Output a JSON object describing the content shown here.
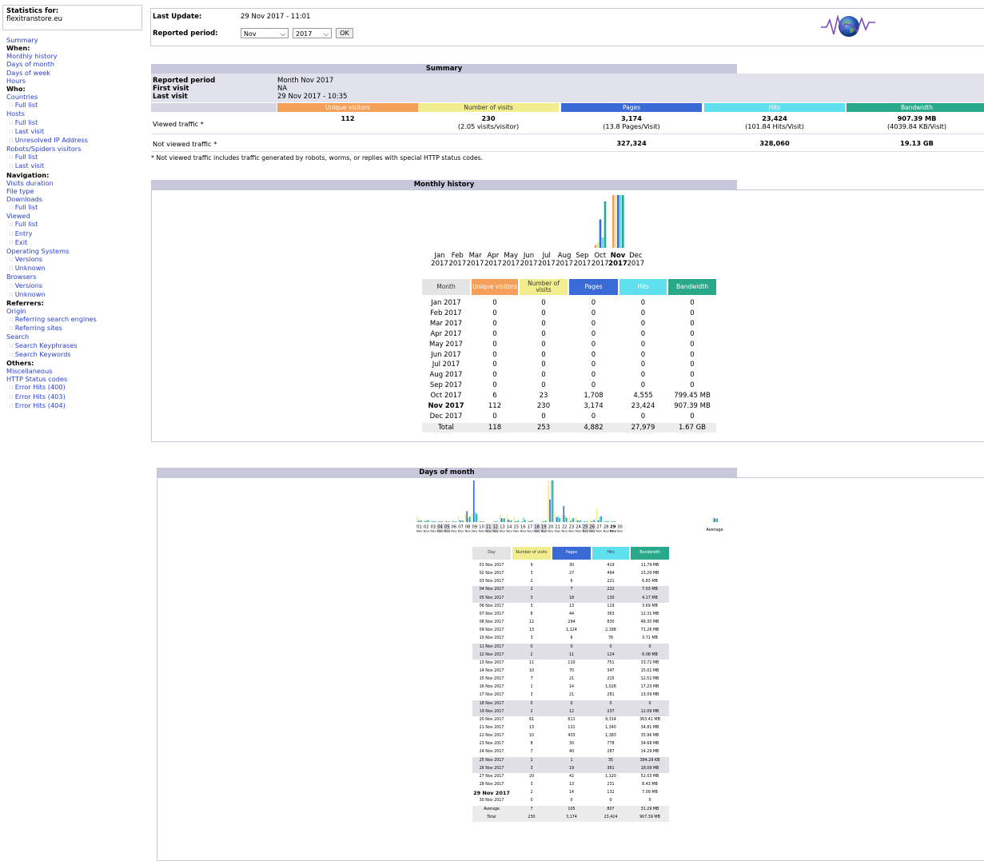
{
  "sidebar": {
    "stats_label": "Statistics for:",
    "domain": "flexitranstore.eu",
    "menu": [
      {
        "t": "Summary",
        "k": "l"
      },
      {
        "t": "When:",
        "k": "h"
      },
      {
        "t": "Monthly history",
        "k": "l"
      },
      {
        "t": "Days of month",
        "k": "l"
      },
      {
        "t": "Days of week",
        "k": "l"
      },
      {
        "t": "Hours",
        "k": "l"
      },
      {
        "t": "Who:",
        "k": "h"
      },
      {
        "t": "Countries",
        "k": "l"
      },
      {
        "t": "Full list",
        "k": "s"
      },
      {
        "t": "Hosts",
        "k": "l"
      },
      {
        "t": "Full list",
        "k": "s"
      },
      {
        "t": "Last visit",
        "k": "s"
      },
      {
        "t": "Unresolved IP Address",
        "k": "s"
      },
      {
        "t": "Robots/Spiders visitors",
        "k": "l"
      },
      {
        "t": "Full list",
        "k": "s"
      },
      {
        "t": "Last visit",
        "k": "s"
      },
      {
        "t": "Navigation:",
        "k": "h"
      },
      {
        "t": "Visits duration",
        "k": "l"
      },
      {
        "t": "File type",
        "k": "l"
      },
      {
        "t": "Downloads",
        "k": "l"
      },
      {
        "t": "Full list",
        "k": "s"
      },
      {
        "t": "Viewed",
        "k": "l"
      },
      {
        "t": "Full list",
        "k": "s"
      },
      {
        "t": "Entry",
        "k": "s"
      },
      {
        "t": "Exit",
        "k": "s"
      },
      {
        "t": "Operating Systems",
        "k": "l"
      },
      {
        "t": "Versions",
        "k": "s"
      },
      {
        "t": "Unknown",
        "k": "s"
      },
      {
        "t": "Browsers",
        "k": "l"
      },
      {
        "t": "Versions",
        "k": "s"
      },
      {
        "t": "Unknown",
        "k": "s"
      },
      {
        "t": "Referrers:",
        "k": "h"
      },
      {
        "t": "Origin",
        "k": "l"
      },
      {
        "t": "Referring search engines",
        "k": "s"
      },
      {
        "t": "Referring sites",
        "k": "s"
      },
      {
        "t": "Search",
        "k": "l"
      },
      {
        "t": "Search Keyphrases",
        "k": "s"
      },
      {
        "t": "Search Keywords",
        "k": "s"
      },
      {
        "t": "Others:",
        "k": "h"
      },
      {
        "t": "Miscellaneous",
        "k": "l"
      },
      {
        "t": "HTTP Status codes",
        "k": "l"
      },
      {
        "t": "Error Hits (400)",
        "k": "s"
      },
      {
        "t": "Error Hits (403)",
        "k": "s"
      },
      {
        "t": "Error Hits (404)",
        "k": "s"
      }
    ]
  },
  "header": {
    "last_update_label": "Last Update:",
    "last_update_value": "29 Nov 2017 - 11:01",
    "period_label": "Reported period:",
    "month_select": "Nov",
    "year_select": "2017",
    "ok_label": "OK"
  },
  "summary": {
    "title": "Summary",
    "reported_period_label": "Reported period",
    "reported_period_value": "Month Nov 2017",
    "first_visit_label": "First visit",
    "first_visit_value": "NA",
    "last_visit_label": "Last visit",
    "last_visit_value": "29 Nov 2017 - 10:35",
    "col_headers": [
      "Unique visitors",
      "Number of visits",
      "Pages",
      "Hits",
      "Bandwidth"
    ],
    "viewed_label": "Viewed traffic *",
    "viewed": [
      {
        "main": "112",
        "sub": ""
      },
      {
        "main": "230",
        "sub": "(2.05 visits/visitor)"
      },
      {
        "main": "3,174",
        "sub": "(13.8 Pages/Visit)"
      },
      {
        "main": "23,424",
        "sub": "(101.84 Hits/Visit)"
      },
      {
        "main": "907.39 MB",
        "sub": "(4039.84 KB/Visit)"
      }
    ],
    "not_viewed_label": "Not viewed traffic *",
    "not_viewed": [
      "",
      "",
      "327,324",
      "328,060",
      "19.13 GB"
    ],
    "footnote": "* Not viewed traffic includes traffic generated by robots, worms, or replies with special HTTP status codes."
  },
  "colors": {
    "unique": "#f5a05a",
    "visits": "#f2ee90",
    "pages": "#3a6ad6",
    "hits": "#5ee0ee",
    "bandwidth": "#2aa88a",
    "section_bar": "#c8c8dc"
  },
  "monthly": {
    "title": "Monthly history",
    "chart_labels": [
      {
        "m": "Jan",
        "y": "2017"
      },
      {
        "m": "Feb",
        "y": "2017"
      },
      {
        "m": "Mar",
        "y": "2017"
      },
      {
        "m": "Apr",
        "y": "2017"
      },
      {
        "m": "May",
        "y": "2017"
      },
      {
        "m": "Jun",
        "y": "2017"
      },
      {
        "m": "Jul",
        "y": "2017"
      },
      {
        "m": "Aug",
        "y": "2017"
      },
      {
        "m": "Sep",
        "y": "2017"
      },
      {
        "m": "Oct",
        "y": "2017"
      },
      {
        "m": "Nov",
        "y": "2017"
      },
      {
        "m": "Dec",
        "y": "2017"
      }
    ],
    "headers": [
      "Month",
      "Unique visitors",
      "Number of visits",
      "Pages",
      "Hits",
      "Bandwidth"
    ],
    "rows": [
      [
        "Jan 2017",
        "0",
        "0",
        "0",
        "0",
        "0"
      ],
      [
        "Feb 2017",
        "0",
        "0",
        "0",
        "0",
        "0"
      ],
      [
        "Mar 2017",
        "0",
        "0",
        "0",
        "0",
        "0"
      ],
      [
        "Apr 2017",
        "0",
        "0",
        "0",
        "0",
        "0"
      ],
      [
        "May 2017",
        "0",
        "0",
        "0",
        "0",
        "0"
      ],
      [
        "Jun 2017",
        "0",
        "0",
        "0",
        "0",
        "0"
      ],
      [
        "Jul 2017",
        "0",
        "0",
        "0",
        "0",
        "0"
      ],
      [
        "Aug 2017",
        "0",
        "0",
        "0",
        "0",
        "0"
      ],
      [
        "Sep 2017",
        "0",
        "0",
        "0",
        "0",
        "0"
      ],
      [
        "Oct 2017",
        "6",
        "23",
        "1,708",
        "4,555",
        "799.45 MB"
      ],
      [
        "Nov 2017",
        "112",
        "230",
        "3,174",
        "23,424",
        "907.39 MB"
      ],
      [
        "Dec 2017",
        "0",
        "0",
        "0",
        "0",
        "0"
      ]
    ],
    "total": [
      "Total",
      "118",
      "253",
      "4,882",
      "27,979",
      "1.67 GB"
    ]
  },
  "days": {
    "title": "Days of month",
    "average_label": "Average",
    "headers": [
      "Day",
      "Number of visits",
      "Pages",
      "Hits",
      "Bandwidth"
    ],
    "rows": [
      [
        "01 Nov 2017",
        "9",
        "30",
        "419",
        "11.79 MB"
      ],
      [
        "02 Nov 2017",
        "3",
        "27",
        "494",
        "13.29 MB"
      ],
      [
        "03 Nov 2017",
        "2",
        "6",
        "221",
        "6.83 MB"
      ],
      [
        "04 Nov 2017",
        "2",
        "7",
        "222",
        "7.03 MB"
      ],
      [
        "05 Nov 2017",
        "3",
        "18",
        "130",
        "4.17 MB"
      ],
      [
        "06 Nov 2017",
        "3",
        "13",
        "119",
        "3.69 MB"
      ],
      [
        "07 Nov 2017",
        "8",
        "44",
        "363",
        "12.31 MB"
      ],
      [
        "08 Nov 2017",
        "12",
        "294",
        "830",
        "48.30 MB"
      ],
      [
        "09 Nov 2017",
        "13",
        "1,124",
        "2,188",
        "71.26 MB"
      ],
      [
        "10 Nov 2017",
        "3",
        "6",
        "76",
        "3.71 MB"
      ],
      [
        "11 Nov 2017",
        "0",
        "0",
        "0",
        "0"
      ],
      [
        "12 Nov 2017",
        "2",
        "11",
        "124",
        "6.08 MB"
      ],
      [
        "13 Nov 2017",
        "11",
        "110",
        "751",
        "33.72 MB"
      ],
      [
        "14 Nov 2017",
        "10",
        "70",
        "347",
        "15.01 MB"
      ],
      [
        "15 Nov 2017",
        "7",
        "21",
        "215",
        "12.52 MB"
      ],
      [
        "16 Nov 2017",
        "1",
        "14",
        "1,028",
        "17.23 MB"
      ],
      [
        "17 Nov 2017",
        "3",
        "21",
        "281",
        "13.09 MB"
      ],
      [
        "18 Nov 2017",
        "0",
        "0",
        "0",
        "0"
      ],
      [
        "19 Nov 2017",
        "2",
        "12",
        "237",
        "12.09 MB"
      ],
      [
        "20 Nov 2017",
        "61",
        "611",
        "9,314",
        "363.41 MB"
      ],
      [
        "21 Nov 2017",
        "13",
        "131",
        "1,340",
        "34.81 MB"
      ],
      [
        "22 Nov 2017",
        "10",
        "433",
        "1,383",
        "35.96 MB"
      ],
      [
        "23 Nov 2017",
        "8",
        "30",
        "778",
        "34.68 MB"
      ],
      [
        "24 Nov 2017",
        "7",
        "40",
        "287",
        "14.29 MB"
      ],
      [
        "25 Nov 2017",
        "1",
        "1",
        "35",
        "384.29 KB"
      ],
      [
        "26 Nov 2017",
        "3",
        "19",
        "361",
        "18.09 MB"
      ],
      [
        "27 Nov 2017",
        "20",
        "42",
        "1,120",
        "52.03 MB"
      ],
      [
        "28 Nov 2017",
        "3",
        "13",
        "231",
        "8.43 MB"
      ],
      [
        "29 Nov 2017",
        "2",
        "14",
        "132",
        "7.09 MB"
      ],
      [
        "30 Nov 2017",
        "0",
        "0",
        "0",
        "0"
      ]
    ],
    "average": [
      "Average",
      "7",
      "105",
      "807",
      "31.29 MB"
    ],
    "total": [
      "Total",
      "230",
      "3,174",
      "23,424",
      "907.39 MB"
    ],
    "chart_days": [
      "01",
      "02",
      "03",
      "04",
      "05",
      "06",
      "07",
      "08",
      "09",
      "10",
      "11",
      "12",
      "13",
      "14",
      "15",
      "16",
      "17",
      "18",
      "19",
      "20",
      "21",
      "22",
      "23",
      "24",
      "25",
      "26",
      "27",
      "28",
      "29",
      "30"
    ],
    "chart_month": "Nov"
  },
  "chart_data": [
    {
      "type": "bar",
      "title": "Monthly history",
      "categories": [
        "Jan 2017",
        "Feb 2017",
        "Mar 2017",
        "Apr 2017",
        "May 2017",
        "Jun 2017",
        "Jul 2017",
        "Aug 2017",
        "Sep 2017",
        "Oct 2017",
        "Nov 2017",
        "Dec 2017"
      ],
      "series": [
        {
          "name": "Unique visitors",
          "values": [
            0,
            0,
            0,
            0,
            0,
            0,
            0,
            0,
            0,
            6,
            112,
            0
          ]
        },
        {
          "name": "Number of visits",
          "values": [
            0,
            0,
            0,
            0,
            0,
            0,
            0,
            0,
            0,
            23,
            230,
            0
          ]
        },
        {
          "name": "Pages",
          "values": [
            0,
            0,
            0,
            0,
            0,
            0,
            0,
            0,
            0,
            1708,
            3174,
            0
          ]
        },
        {
          "name": "Hits",
          "values": [
            0,
            0,
            0,
            0,
            0,
            0,
            0,
            0,
            0,
            4555,
            23424,
            0
          ]
        },
        {
          "name": "Bandwidth",
          "values": [
            0,
            0,
            0,
            0,
            0,
            0,
            0,
            0,
            0,
            799.45,
            907.39,
            0
          ]
        }
      ]
    },
    {
      "type": "bar",
      "title": "Days of month",
      "categories": [
        "01",
        "02",
        "03",
        "04",
        "05",
        "06",
        "07",
        "08",
        "09",
        "10",
        "11",
        "12",
        "13",
        "14",
        "15",
        "16",
        "17",
        "18",
        "19",
        "20",
        "21",
        "22",
        "23",
        "24",
        "25",
        "26",
        "27",
        "28",
        "29",
        "30"
      ],
      "series": [
        {
          "name": "Number of visits",
          "values": [
            9,
            3,
            2,
            2,
            3,
            3,
            8,
            12,
            13,
            3,
            0,
            2,
            11,
            10,
            7,
            1,
            3,
            0,
            2,
            61,
            13,
            10,
            8,
            7,
            1,
            3,
            20,
            3,
            2,
            0
          ]
        },
        {
          "name": "Pages",
          "values": [
            30,
            27,
            6,
            7,
            18,
            13,
            44,
            294,
            1124,
            6,
            0,
            11,
            110,
            70,
            21,
            14,
            21,
            0,
            12,
            611,
            131,
            433,
            30,
            40,
            1,
            19,
            42,
            13,
            14,
            0
          ]
        },
        {
          "name": "Hits",
          "values": [
            419,
            494,
            221,
            222,
            130,
            119,
            363,
            830,
            2188,
            76,
            0,
            124,
            751,
            347,
            215,
            1028,
            281,
            0,
            237,
            9314,
            1340,
            1383,
            778,
            287,
            35,
            361,
            1120,
            231,
            132,
            0
          ]
        },
        {
          "name": "Bandwidth",
          "values": [
            11.79,
            13.29,
            6.83,
            7.03,
            4.17,
            3.69,
            12.31,
            48.3,
            71.26,
            3.71,
            0,
            6.08,
            33.72,
            15.01,
            12.52,
            17.23,
            13.09,
            0,
            12.09,
            363.41,
            34.81,
            35.96,
            34.68,
            14.29,
            0.38,
            18.09,
            52.03,
            8.43,
            7.09,
            0
          ]
        }
      ]
    }
  ]
}
